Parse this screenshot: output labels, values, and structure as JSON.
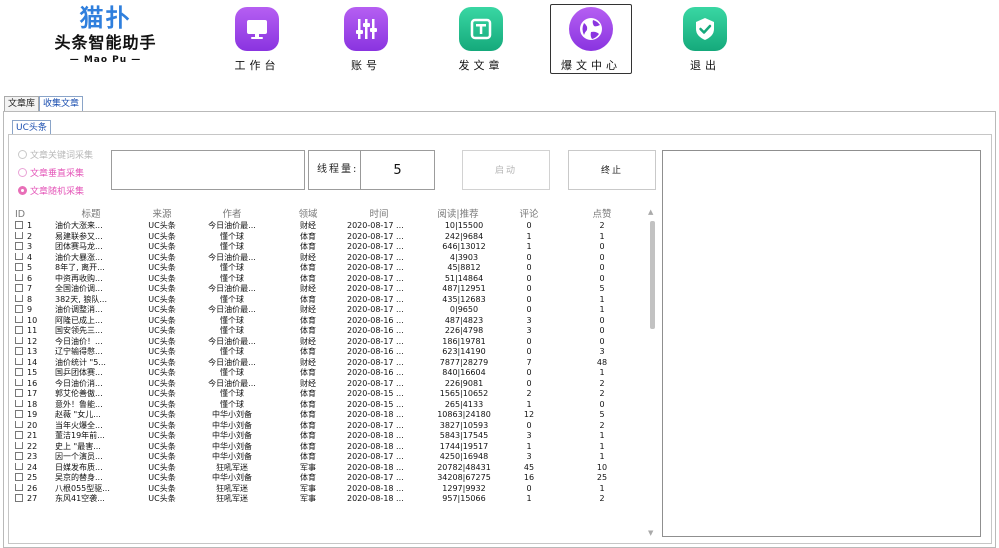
{
  "logo": {
    "mark": "猫扑",
    "title": "头条智能助手",
    "subtitle": "— Mao Pu —"
  },
  "nav": [
    {
      "label": "工作台",
      "icon": "monitor-icon"
    },
    {
      "label": "账号",
      "icon": "sliders-icon"
    },
    {
      "label": "发文章",
      "icon": "publish-icon"
    },
    {
      "label": "爆文中心",
      "icon": "globe-icon"
    },
    {
      "label": "退出",
      "icon": "shield-check-icon"
    }
  ],
  "tabs": {
    "outer": [
      "文章库",
      "收集文章"
    ],
    "inner": [
      "UC头条"
    ]
  },
  "modes": [
    "文章关键词采集",
    "文章垂直采集",
    "文章随机采集"
  ],
  "keyword_input": "",
  "thread": {
    "label": "线程量:",
    "value": "5"
  },
  "buttons": {
    "start": "启动",
    "stop": "终止"
  },
  "table": {
    "headers": [
      "ID",
      "标题",
      "来源",
      "作者",
      "领域",
      "时间",
      "阅读|推荐",
      "评论",
      "点赞"
    ],
    "rows": [
      [
        "1",
        "油价大涨来...",
        "UC头条",
        "今日油价最...",
        "财经",
        "2020-08-17 ...",
        "10|15500",
        "0",
        "2"
      ],
      [
        "2",
        "易建联参又...",
        "UC头条",
        "懂个球",
        "体育",
        "2020-08-17 ...",
        "242|9684",
        "1",
        "1"
      ],
      [
        "3",
        "团体赛马龙...",
        "UC头条",
        "懂个球",
        "体育",
        "2020-08-17 ...",
        "646|13012",
        "1",
        "0"
      ],
      [
        "4",
        "油价大暴涨...",
        "UC头条",
        "今日油价最...",
        "财经",
        "2020-08-17 ...",
        "4|3903",
        "0",
        "0"
      ],
      [
        "5",
        "8年了, 离开...",
        "UC头条",
        "懂个球",
        "体育",
        "2020-08-17 ...",
        "45|8812",
        "0",
        "0"
      ],
      [
        "6",
        "中资再收购...",
        "UC头条",
        "懂个球",
        "体育",
        "2020-08-17 ...",
        "51|14864",
        "0",
        "0"
      ],
      [
        "7",
        "全国油价调...",
        "UC头条",
        "今日油价最...",
        "财经",
        "2020-08-17 ...",
        "487|12951",
        "0",
        "5"
      ],
      [
        "8",
        "382天, 狼队...",
        "UC头条",
        "懂个球",
        "体育",
        "2020-08-17 ...",
        "435|12683",
        "0",
        "1"
      ],
      [
        "9",
        "油价调整消...",
        "UC头条",
        "今日油价最...",
        "财经",
        "2020-08-17 ...",
        "0|9650",
        "0",
        "1"
      ],
      [
        "10",
        "阿隆已成上...",
        "UC头条",
        "懂个球",
        "体育",
        "2020-08-16 ...",
        "487|4823",
        "3",
        "0"
      ],
      [
        "11",
        "国安领先三...",
        "UC头条",
        "懂个球",
        "体育",
        "2020-08-16 ...",
        "226|4798",
        "3",
        "0"
      ],
      [
        "12",
        "今日油价！...",
        "UC头条",
        "今日油价最...",
        "财经",
        "2020-08-17 ...",
        "186|19781",
        "0",
        "0"
      ],
      [
        "13",
        "辽宁输得憋...",
        "UC头条",
        "懂个球",
        "体育",
        "2020-08-16 ...",
        "623|14190",
        "0",
        "3"
      ],
      [
        "14",
        "油价统计 \"5...",
        "UC头条",
        "今日油价最...",
        "财经",
        "2020-08-17 ...",
        "7877|28279",
        "7",
        "48"
      ],
      [
        "15",
        "国乒团体赛...",
        "UC头条",
        "懂个球",
        "体育",
        "2020-08-16 ...",
        "840|16604",
        "0",
        "1"
      ],
      [
        "16",
        "今日油价消...",
        "UC头条",
        "今日油价最...",
        "财经",
        "2020-08-17 ...",
        "226|9081",
        "0",
        "2"
      ],
      [
        "17",
        "郭艾伦善傲...",
        "UC头条",
        "懂个球",
        "体育",
        "2020-08-15 ...",
        "1565|10652",
        "2",
        "2"
      ],
      [
        "18",
        "意外！鲁能...",
        "UC头条",
        "懂个球",
        "体育",
        "2020-08-15 ...",
        "265|4133",
        "1",
        "0"
      ],
      [
        "19",
        "赵薇 \"女儿...",
        "UC头条",
        "中华小刘备",
        "体育",
        "2020-08-18 ...",
        "10863|24180",
        "12",
        "5"
      ],
      [
        "20",
        "当年火爆全...",
        "UC头条",
        "中华小刘备",
        "体育",
        "2020-08-17 ...",
        "3827|10593",
        "0",
        "2"
      ],
      [
        "21",
        "董洁19年前...",
        "UC头条",
        "中华小刘备",
        "体育",
        "2020-08-18 ...",
        "5843|17545",
        "3",
        "1"
      ],
      [
        "22",
        "史上 \"最害...",
        "UC头条",
        "中华小刘备",
        "体育",
        "2020-08-18 ...",
        "1744|19517",
        "1",
        "1"
      ],
      [
        "23",
        "因一个演员...",
        "UC头条",
        "中华小刘备",
        "体育",
        "2020-08-17 ...",
        "4250|16948",
        "3",
        "1"
      ],
      [
        "24",
        "日媒发布质...",
        "UC头条",
        "狂吼军迷",
        "军事",
        "2020-08-18 ...",
        "20782|48431",
        "45",
        "10"
      ],
      [
        "25",
        "吴京的替身...",
        "UC头条",
        "中华小刘备",
        "体育",
        "2020-08-17 ...",
        "34208|67275",
        "16",
        "25"
      ],
      [
        "26",
        "八根055型驱...",
        "UC头条",
        "狂吼军迷",
        "军事",
        "2020-08-18 ...",
        "1297|9932",
        "0",
        "1"
      ],
      [
        "27",
        "东风41空袭...",
        "UC头条",
        "狂吼军迷",
        "军事",
        "2020-08-18 ...",
        "957|15066",
        "1",
        "2"
      ]
    ]
  },
  "colors": {
    "accent_pink": "#e455b8",
    "icon_purple": "#9b45e8",
    "icon_green": "#22c08e"
  }
}
